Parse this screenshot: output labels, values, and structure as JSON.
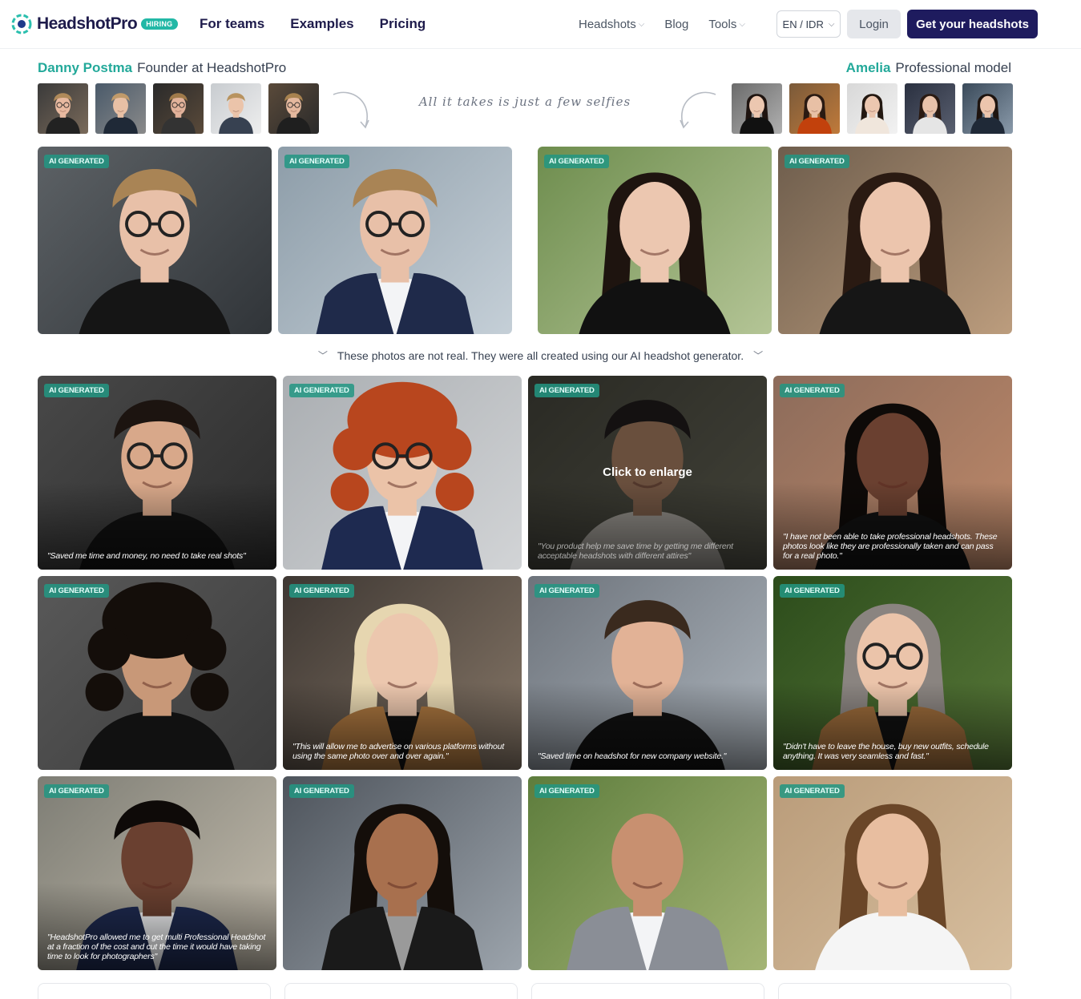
{
  "header": {
    "brand": "HeadshotPro",
    "hiring_badge": "HIRING",
    "nav_main": [
      "For teams",
      "Examples",
      "Pricing"
    ],
    "nav_secondary": [
      {
        "label": "Headshots",
        "dropdown": true
      },
      {
        "label": "Blog",
        "dropdown": false
      },
      {
        "label": "Tools",
        "dropdown": true
      }
    ],
    "language": "EN / IDR",
    "login": "Login",
    "cta": "Get your headshots",
    "accent_color": "#23a99a",
    "cta_color": "#1e1b5e"
  },
  "showcase": {
    "left_persona": {
      "name": "Danny Postma",
      "role": "Founder at HeadshotPro"
    },
    "right_persona": {
      "name": "Amelia",
      "role": "Professional model"
    },
    "tagline": "All it takes is just a few selfies",
    "badge": "AI GENERATED",
    "notice": "These photos are not real. They were all created using our AI headshot generator."
  },
  "gallery": {
    "badge": "AI GENERATED",
    "hover_label": "Click to enlarge",
    "quotes": {
      "q1": "\"Saved me time and money, no need to take real shots\"",
      "q3": "\"You product help me save time by getting me different acceptable headshots with different attires\"",
      "q4": "\"I have not been able to take professional headshots. These photos look like they are professionally taken and can pass for a real photo.\"",
      "q6": "\"This will allow me to advertise on various platforms without using the same photo over and over again.\"",
      "q7": "\"Saved time on headshot for new company website.\"",
      "q8": "\"Didn't have to leave the house, buy new outfits, schedule anything. It was very seamless and fast.\"",
      "q9": "\"HeadshotPro allowed me to get multi Professional Headshot at a fraction of the cost and cut the time it would have taking time to look for photographers\""
    }
  }
}
